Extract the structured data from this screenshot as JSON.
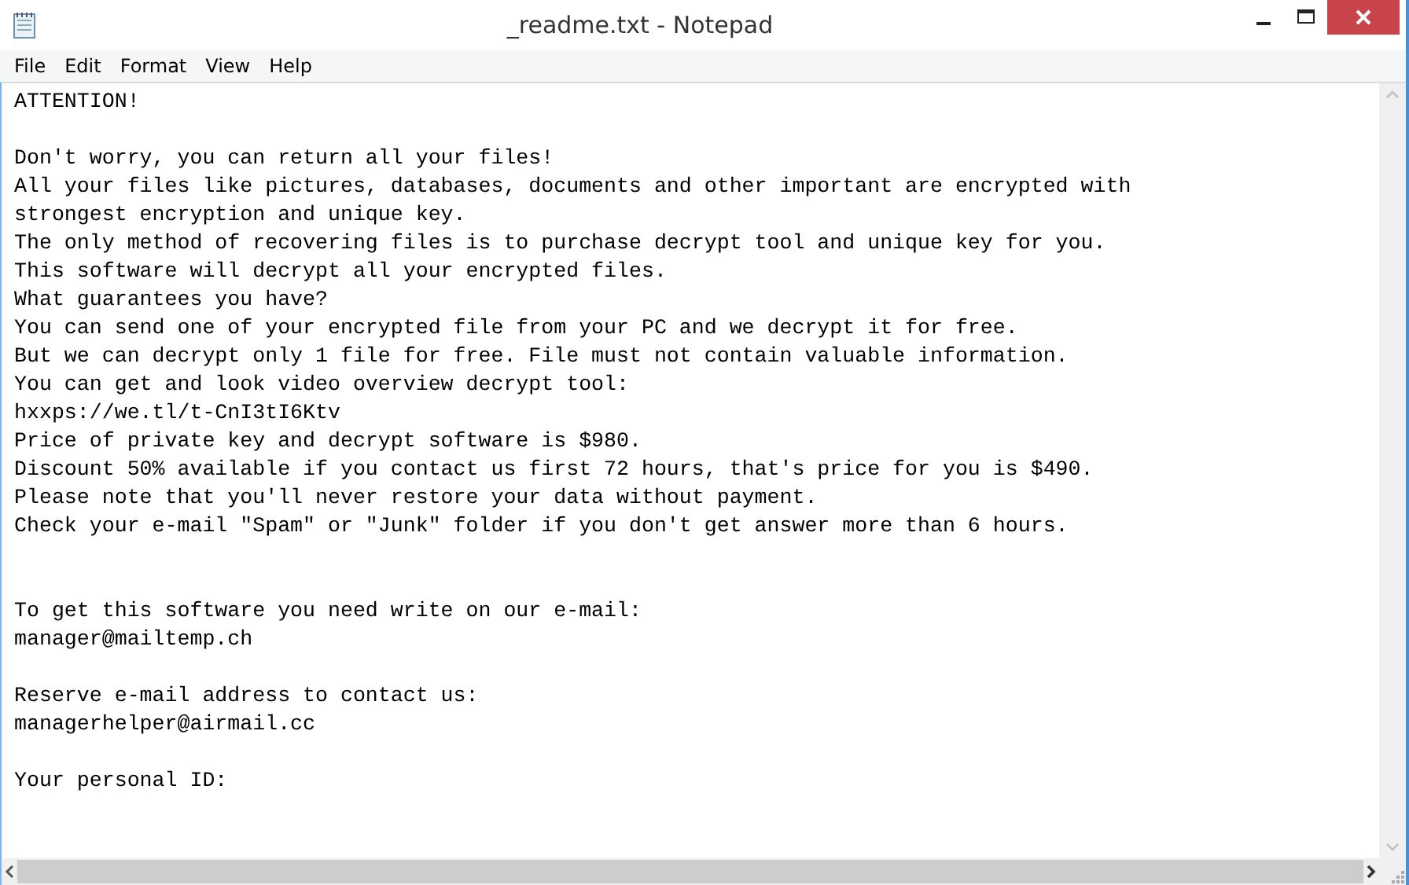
{
  "window": {
    "title": "_readme.txt - Notepad"
  },
  "menu": [
    "File",
    "Edit",
    "Format",
    "View",
    "Help"
  ],
  "lines": [
    {
      "kind": "text",
      "text": "ATTENTION!"
    },
    {
      "kind": "blank"
    },
    {
      "kind": "text",
      "text": "Don't worry, you can return all your files!"
    },
    {
      "kind": "text",
      "text": "All your files like pictures, databases, documents and other important are encrypted with"
    },
    {
      "kind": "text",
      "text": "strongest encryption and unique key."
    },
    {
      "kind": "text",
      "text": "The only method of recovering files is to purchase decrypt tool and unique key for you."
    },
    {
      "kind": "text",
      "text": "This software will decrypt all your encrypted files."
    },
    {
      "kind": "text",
      "text": "What guarantees you have?"
    },
    {
      "kind": "text",
      "text": "You can send one of your encrypted file from your PC and we decrypt it for free."
    },
    {
      "kind": "text",
      "text": "But we can decrypt only 1 file for free. File must not contain valuable information."
    },
    {
      "kind": "text",
      "text": "You can get and look video overview decrypt tool:"
    },
    {
      "kind": "text",
      "text": "hxxps://we.tl/t-CnI3tI6Ktv"
    },
    {
      "kind": "text",
      "text": "Price of private key and decrypt software is $980."
    },
    {
      "kind": "text",
      "text": "Discount 50% available if you contact us first 72 hours, that's price for you is $490."
    },
    {
      "kind": "text",
      "text": "Please note that you'll never restore your data without payment."
    },
    {
      "kind": "text",
      "text": "Check your e-mail \"Spam\" or \"Junk\" folder if you don't get answer more than 6 hours."
    },
    {
      "kind": "blank"
    },
    {
      "kind": "blank"
    },
    {
      "kind": "text",
      "text": "To get this software you need write on our e-mail:"
    },
    {
      "kind": "text",
      "text": "manager@mailtemp.ch"
    },
    {
      "kind": "blank"
    },
    {
      "kind": "text",
      "text": "Reserve e-mail address to contact us:"
    },
    {
      "kind": "text",
      "text": "managerhelper@airmail.cc"
    },
    {
      "kind": "blank"
    },
    {
      "kind": "text",
      "text": "Your personal ID:"
    }
  ]
}
